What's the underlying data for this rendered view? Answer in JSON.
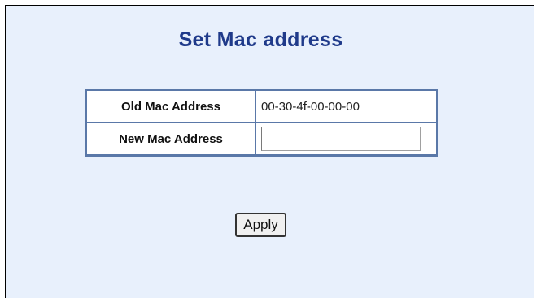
{
  "page": {
    "title": "Set Mac address"
  },
  "table": {
    "old_mac": {
      "label": "Old Mac Address",
      "value": "00-30-4f-00-00-00"
    },
    "new_mac": {
      "label": "New Mac Address",
      "value": "",
      "placeholder": ""
    }
  },
  "actions": {
    "apply_label": "Apply"
  },
  "colors": {
    "background": "#e8f0fc",
    "title": "#1f3a8a",
    "table_border": "#5a78a8"
  }
}
